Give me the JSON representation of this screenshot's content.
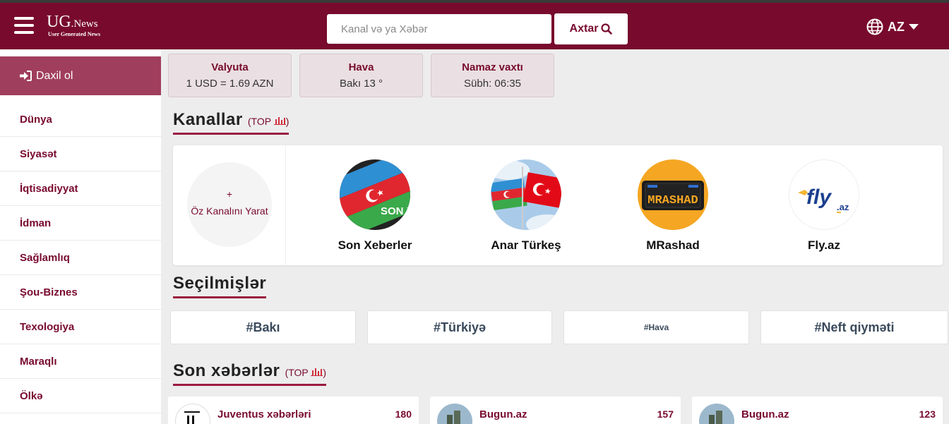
{
  "header": {
    "logo_main": "UG",
    "logo_suffix": ".News",
    "logo_sub": "User Generated News",
    "search_placeholder": "Kanal və ya Xəbər",
    "search_button": "Axtar",
    "language": "AZ"
  },
  "sidebar": {
    "login": "Daxil ol",
    "items": [
      "Dünya",
      "Siyasət",
      "İqtisadiyyat",
      "İdman",
      "Sağlamlıq",
      "Şou-Biznes",
      "Texologiya",
      "Maraqlı",
      "Ölkə"
    ]
  },
  "info": [
    {
      "title": "Valyuta",
      "value": "1 USD = 1.69 AZN"
    },
    {
      "title": "Hava",
      "value": "Bakı 13 °"
    },
    {
      "title": "Namaz vaxtı",
      "value": "Sübh: 06:35"
    }
  ],
  "channels_section": {
    "title": "Kanallar",
    "top_prefix": "(TOP",
    "top_suffix": ")",
    "create_plus": "+",
    "create_label": "Öz Kanalını Yarat",
    "channels": [
      {
        "name": "Son Xeberler",
        "avatar_text": "SON XƏBƏR"
      },
      {
        "name": "Anar Türkeş"
      },
      {
        "name": "MRashad",
        "avatar_text": "MRASHAD"
      },
      {
        "name": "Fly.az",
        "avatar_text": "fly",
        "avatar_suffix": ".az"
      }
    ]
  },
  "selected_section": {
    "title": "Seçilmişlər",
    "tags": [
      "#Bakı",
      "#Türkiyə",
      "#Hava",
      "#Neft qiyməti"
    ]
  },
  "news_section": {
    "title": "Son xəbərlər",
    "top_prefix": "(TOP",
    "top_suffix": ")",
    "items": [
      {
        "name": "Juventus xəbərləri",
        "count": "180"
      },
      {
        "name": "Bugun.az",
        "count": "157"
      },
      {
        "name": "Bugun.az",
        "count": "123"
      }
    ]
  },
  "colors": {
    "brand": "#780a2e",
    "login_bg": "#a03e5d",
    "background": "#ededed"
  }
}
